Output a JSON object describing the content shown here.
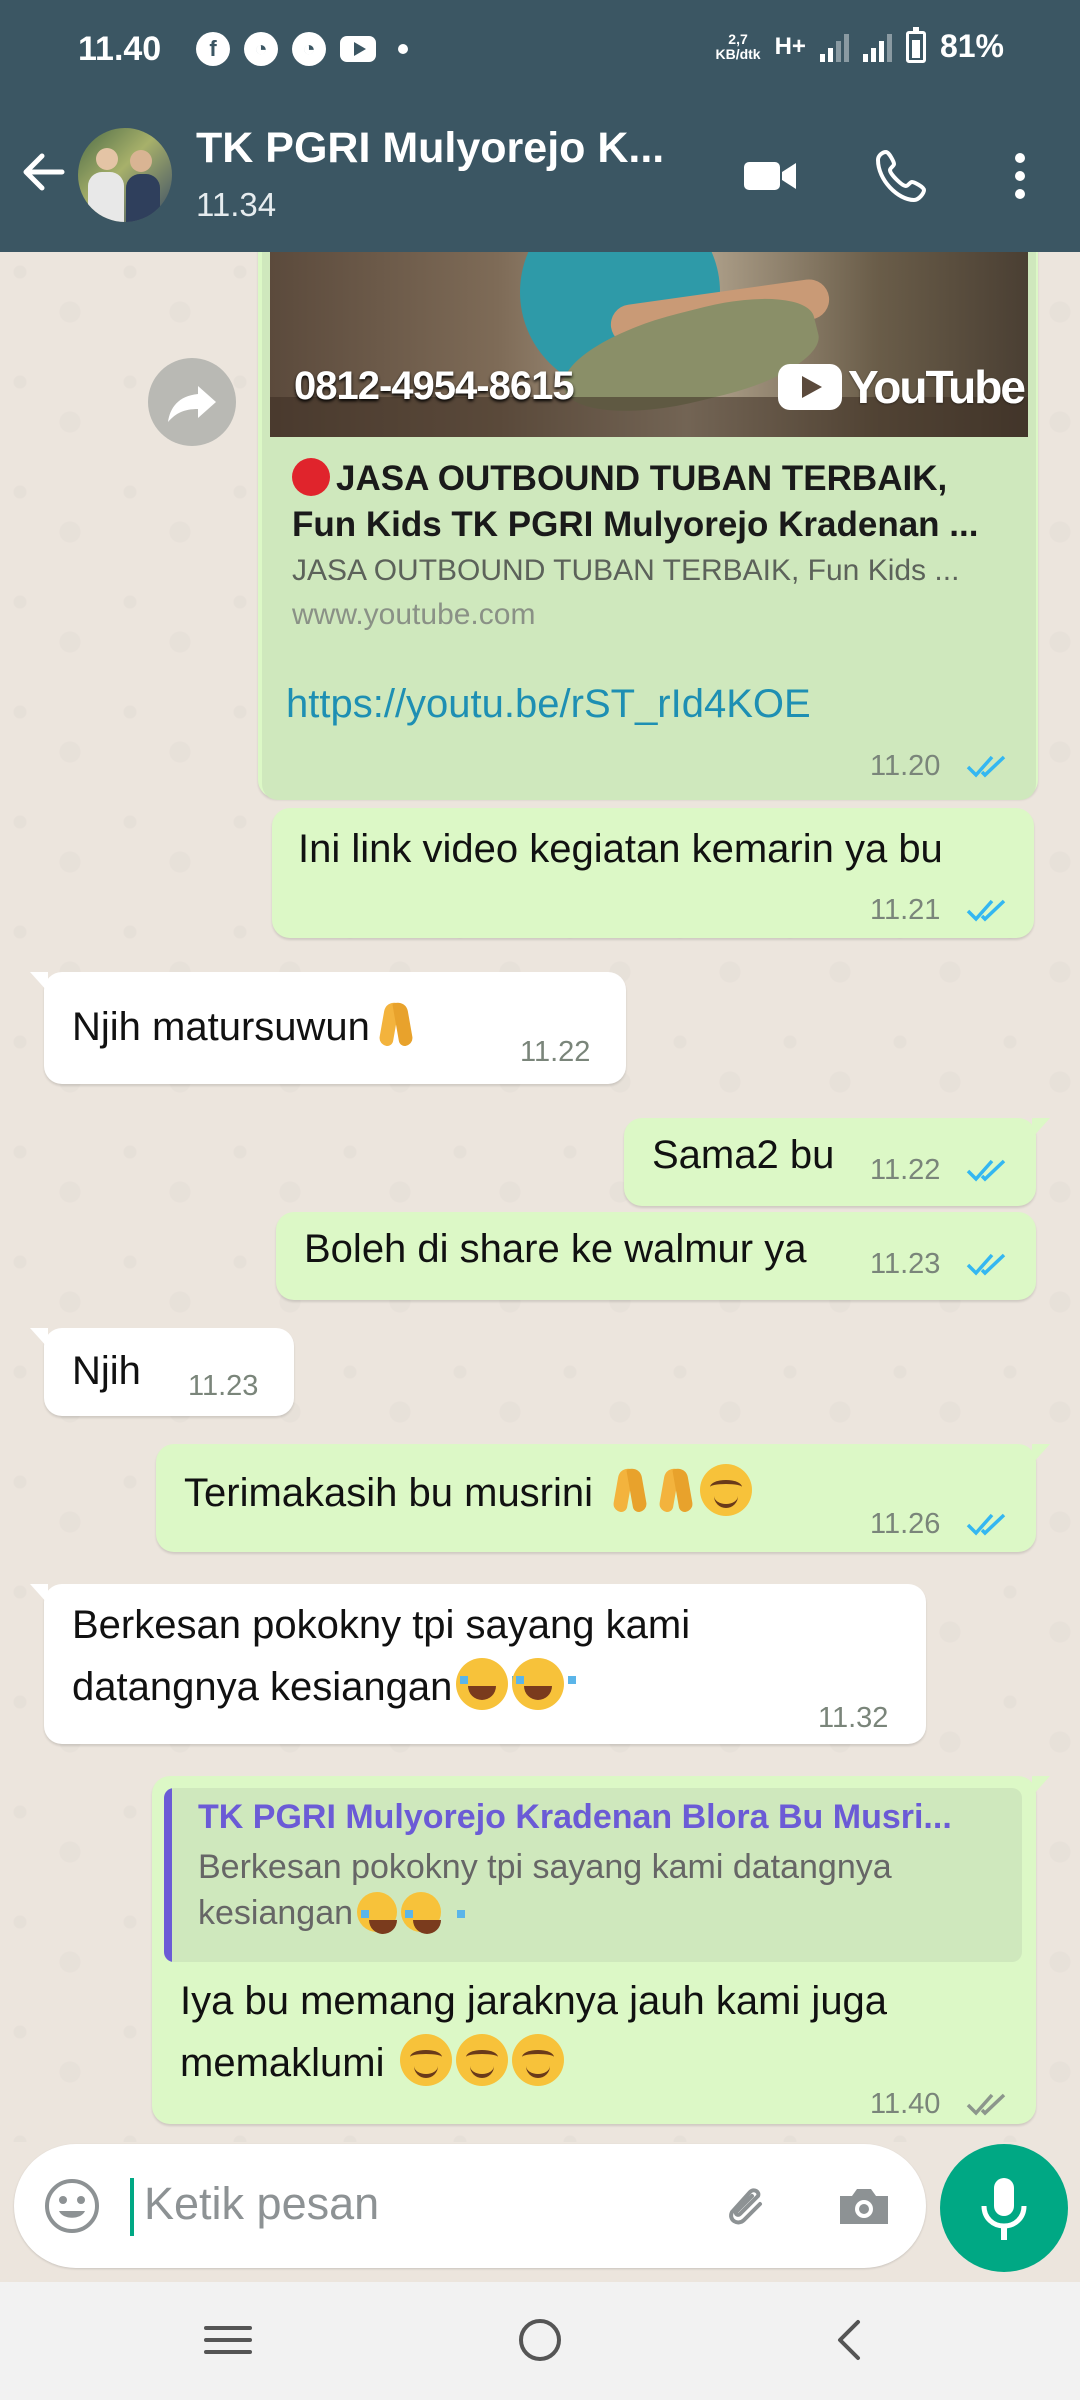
{
  "status_bar": {
    "time": "11.40",
    "speed_value": "2,7",
    "speed_unit": "KB/dtk",
    "network": "H+",
    "battery": "81%",
    "app_icons": [
      "facebook-icon",
      "speed-gauge-icon",
      "speed-gauge-icon",
      "youtube-icon",
      "dot-icon"
    ]
  },
  "header": {
    "title": "TK PGRI Mulyorejo K...",
    "subtitle": "11.34",
    "icons": [
      "back-arrow-icon",
      "video-call-icon",
      "phone-icon",
      "more-vert-icon"
    ]
  },
  "messages": [
    {
      "type": "link_preview",
      "direction": "out",
      "thumbnail_phone": "0812-4954-8615",
      "thumbnail_brand": "YouTube",
      "title_line1": "JASA OUTBOUND TUBAN TERBAIK,",
      "title_line2": "Fun Kids TK PGRI Mulyorejo Kradenan ...",
      "description": "JASA OUTBOUND TUBAN TERBAIK, Fun Kids ...",
      "domain": "www.youtube.com",
      "link": "https://youtu.be/rST_rId4KOE",
      "time": "11.20",
      "status": "read"
    },
    {
      "direction": "out",
      "text": "Ini link video kegiatan kemarin ya bu",
      "time": "11.21",
      "status": "read"
    },
    {
      "direction": "in",
      "text": "Njih matursuwun",
      "emoji": [
        "pray"
      ],
      "time": "11.22"
    },
    {
      "direction": "out",
      "text": "Sama2 bu",
      "time": "11.22",
      "status": "read"
    },
    {
      "direction": "out",
      "text": "Boleh di share ke walmur ya",
      "time": "11.23",
      "status": "read"
    },
    {
      "direction": "in",
      "text": "Njih",
      "time": "11.23"
    },
    {
      "direction": "out",
      "text": "Terimakasih bu musrini",
      "emoji": [
        "pray",
        "pray",
        "smiling-face"
      ],
      "time": "11.26",
      "status": "read"
    },
    {
      "direction": "in",
      "line1": "Berkesan pokokny tpi sayang kami",
      "line2": "datangnya kesiangan",
      "emoji": [
        "tears-of-joy",
        "tears-of-joy"
      ],
      "time": "11.32"
    },
    {
      "direction": "out",
      "quoted_name": "TK PGRI Mulyorejo Kradenan Blora Bu Musri...",
      "quoted_line1": "Berkesan pokokny tpi sayang kami datangnya",
      "quoted_line2": "kesiangan",
      "line1": "Iya bu memang jaraknya jauh kami juga",
      "line2": "memaklumi",
      "emoji": [
        "smiling-face",
        "smiling-face",
        "smiling-face"
      ],
      "time": "11.40",
      "status": "delivered"
    }
  ],
  "input": {
    "placeholder": "Ketik pesan",
    "icons": [
      "emoji-icon",
      "attach-icon",
      "camera-icon",
      "mic-icon"
    ]
  },
  "colors": {
    "header": "#3b5663",
    "outgoing_bubble": "#dcf8c6",
    "incoming_bubble": "#ffffff",
    "accent": "#00a884",
    "read_ticks": "#34b7f1",
    "link": "#1e8fb3"
  }
}
